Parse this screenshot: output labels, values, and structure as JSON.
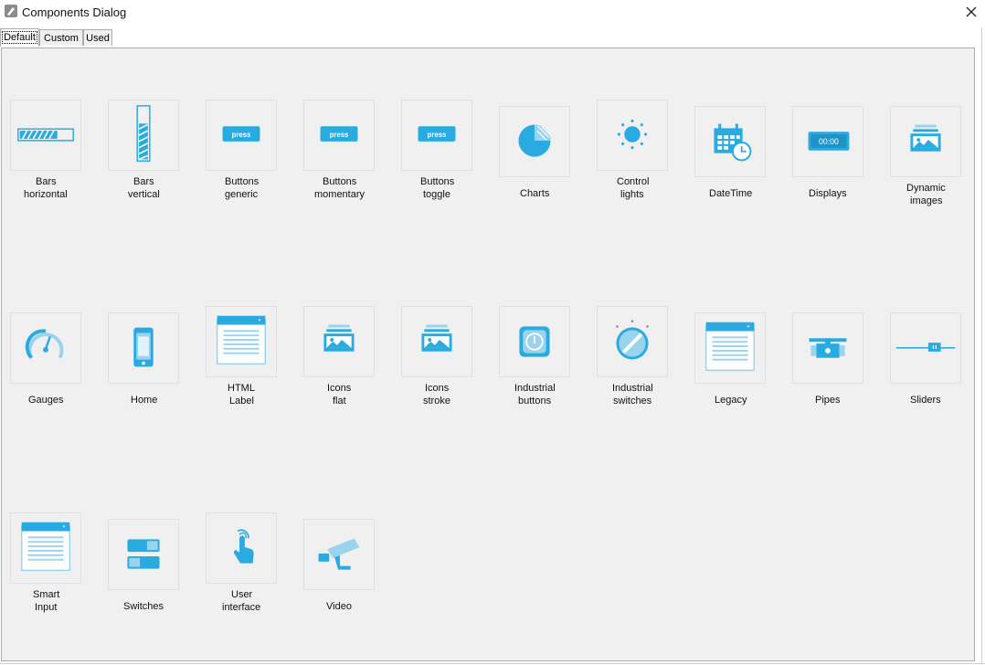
{
  "window": {
    "title": "Components Dialog"
  },
  "tabs": [
    {
      "label": "Default",
      "active": true
    },
    {
      "label": "Custom",
      "active": false
    },
    {
      "label": "Used",
      "active": false
    }
  ],
  "colors": {
    "accent": "#29abe2",
    "accent_light": "#9ad3ee",
    "panel": "#f0f0f0"
  },
  "components": [
    {
      "l1": "Bars",
      "l2": "horizontal",
      "icon": "bars-horizontal-icon"
    },
    {
      "l1": "Bars",
      "l2": "vertical",
      "icon": "bars-vertical-icon"
    },
    {
      "l1": "Buttons",
      "l2": "generic",
      "icon": "button-press-icon",
      "icon_text": "press"
    },
    {
      "l1": "Buttons",
      "l2": "momentary",
      "icon": "button-press-icon",
      "icon_text": "press"
    },
    {
      "l1": "Buttons",
      "l2": "toggle",
      "icon": "button-press-icon",
      "icon_text": "press"
    },
    {
      "l1": "Charts",
      "l2": "",
      "icon": "pie-chart-icon"
    },
    {
      "l1": "Control",
      "l2": "lights",
      "icon": "control-light-icon"
    },
    {
      "l1": "DateTime",
      "l2": "",
      "icon": "calendar-clock-icon"
    },
    {
      "l1": "Displays",
      "l2": "",
      "icon": "display-icon",
      "icon_text": "00:00"
    },
    {
      "l1": "Dynamic",
      "l2": "images",
      "icon": "image-stack-icon"
    },
    {
      "l1": "Gauges",
      "l2": "",
      "icon": "gauge-icon"
    },
    {
      "l1": "Home",
      "l2": "",
      "icon": "phone-icon"
    },
    {
      "l1": "HTML",
      "l2": "Label",
      "icon": "html-window-icon"
    },
    {
      "l1": "Icons",
      "l2": "flat",
      "icon": "image-stack-icon"
    },
    {
      "l1": "Icons",
      "l2": "stroke",
      "icon": "image-stack-icon"
    },
    {
      "l1": "Industrial",
      "l2": "buttons",
      "icon": "industrial-button-icon"
    },
    {
      "l1": "Industrial",
      "l2": "switches",
      "icon": "rotary-switch-icon"
    },
    {
      "l1": "Legacy",
      "l2": "",
      "icon": "html-window-icon"
    },
    {
      "l1": "Pipes",
      "l2": "",
      "icon": "pipe-valve-icon"
    },
    {
      "l1": "Sliders",
      "l2": "",
      "icon": "slider-icon"
    },
    {
      "l1": "Smart",
      "l2": "Input",
      "icon": "html-window-icon"
    },
    {
      "l1": "Switches",
      "l2": "",
      "icon": "toggle-switches-icon"
    },
    {
      "l1": "User",
      "l2": "interface",
      "icon": "touch-hand-icon"
    },
    {
      "l1": "Video",
      "l2": "",
      "icon": "security-camera-icon"
    }
  ]
}
